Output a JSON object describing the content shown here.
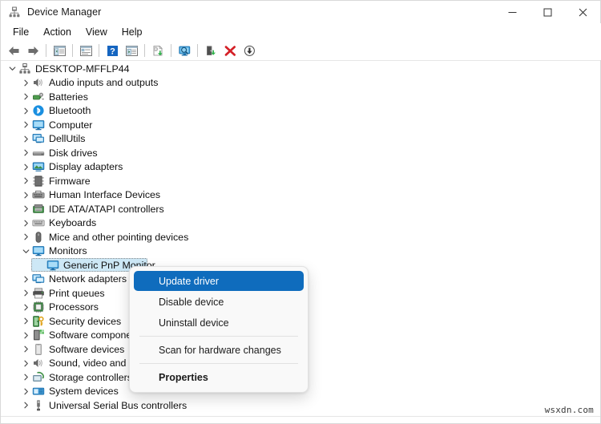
{
  "window": {
    "title": "Device Manager",
    "icon": "device-manager-icon",
    "controls": {
      "minimize": "–",
      "maximize": "□",
      "close": "✕"
    }
  },
  "menubar": {
    "items": [
      {
        "label": "File"
      },
      {
        "label": "Action"
      },
      {
        "label": "View"
      },
      {
        "label": "Help"
      }
    ]
  },
  "toolbar": {
    "buttons": [
      {
        "name": "back-arrow-icon",
        "title": "Back"
      },
      {
        "name": "forward-arrow-icon",
        "title": "Forward"
      },
      {
        "sep": true
      },
      {
        "name": "show-hide-console-tree-icon",
        "title": "Show/Hide Console Tree"
      },
      {
        "sep": true
      },
      {
        "name": "properties-icon",
        "title": "Properties"
      },
      {
        "sep": true
      },
      {
        "name": "help-icon",
        "title": "Help"
      },
      {
        "name": "scan-view-icon",
        "title": "View"
      },
      {
        "sep": true
      },
      {
        "name": "update-driver-icon",
        "title": "Update driver"
      },
      {
        "sep": true
      },
      {
        "name": "scan-hardware-changes-icon",
        "title": "Scan for hardware changes"
      },
      {
        "sep": true
      },
      {
        "name": "enable-device-icon",
        "title": "Enable device"
      },
      {
        "name": "uninstall-device-icon",
        "title": "Uninstall device"
      },
      {
        "name": "disable-device-icon",
        "title": "Disable device"
      }
    ]
  },
  "tree": {
    "root": {
      "label": "DESKTOP-MFFLP44",
      "icon": "computer-root-icon",
      "expanded": true
    },
    "items": [
      {
        "label": "Audio inputs and outputs",
        "icon": "speaker-icon",
        "expanded": false
      },
      {
        "label": "Batteries",
        "icon": "battery-icon",
        "expanded": false
      },
      {
        "label": "Bluetooth",
        "icon": "bluetooth-icon",
        "expanded": false
      },
      {
        "label": "Computer",
        "icon": "monitor-icon",
        "expanded": false
      },
      {
        "label": "DellUtils",
        "icon": "dellutils-icon",
        "expanded": false
      },
      {
        "label": "Disk drives",
        "icon": "disk-drive-icon",
        "expanded": false
      },
      {
        "label": "Display adapters",
        "icon": "display-adapter-icon",
        "expanded": false
      },
      {
        "label": "Firmware",
        "icon": "firmware-icon",
        "expanded": false
      },
      {
        "label": "Human Interface Devices",
        "icon": "hid-icon",
        "expanded": false
      },
      {
        "label": "IDE ATA/ATAPI controllers",
        "icon": "ide-controller-icon",
        "expanded": false
      },
      {
        "label": "Keyboards",
        "icon": "keyboard-icon",
        "expanded": false
      },
      {
        "label": "Mice and other pointing devices",
        "icon": "mouse-icon",
        "expanded": false
      },
      {
        "label": "Monitors",
        "icon": "monitor-icon",
        "expanded": true
      },
      {
        "label": "Generic PnP Monitor",
        "icon": "monitor-icon",
        "child": true,
        "selected": true
      },
      {
        "label": "Network adapters",
        "icon": "network-adapter-icon",
        "expanded": false
      },
      {
        "label": "Print queues",
        "icon": "printer-icon",
        "expanded": false
      },
      {
        "label": "Processors",
        "icon": "processor-icon",
        "expanded": false
      },
      {
        "label": "Security devices",
        "icon": "security-device-icon",
        "expanded": false
      },
      {
        "label": "Software components",
        "icon": "software-component-icon",
        "expanded": false
      },
      {
        "label": "Software devices",
        "icon": "software-device-icon",
        "expanded": false
      },
      {
        "label": "Sound, video and game controllers",
        "icon": "speaker-icon",
        "expanded": false
      },
      {
        "label": "Storage controllers",
        "icon": "storage-controller-icon",
        "expanded": false
      },
      {
        "label": "System devices",
        "icon": "system-device-icon",
        "expanded": false
      },
      {
        "label": "Universal Serial Bus controllers",
        "icon": "usb-icon",
        "expanded": false
      }
    ]
  },
  "context_menu": {
    "items": [
      {
        "label": "Update driver",
        "highlighted": true
      },
      {
        "label": "Disable device"
      },
      {
        "label": "Uninstall device"
      },
      {
        "separator": true
      },
      {
        "label": "Scan for hardware changes"
      },
      {
        "separator": true
      },
      {
        "label": "Properties",
        "bold": true
      }
    ]
  },
  "watermark": {
    "text": "wsxdn.com"
  },
  "colors": {
    "menu_highlight": "#0f6cbd",
    "tree_selection": "#cde8f6",
    "window_bg": "#ffffff",
    "menu_bg": "#f9f9f9",
    "close_hover": "#e81123"
  }
}
